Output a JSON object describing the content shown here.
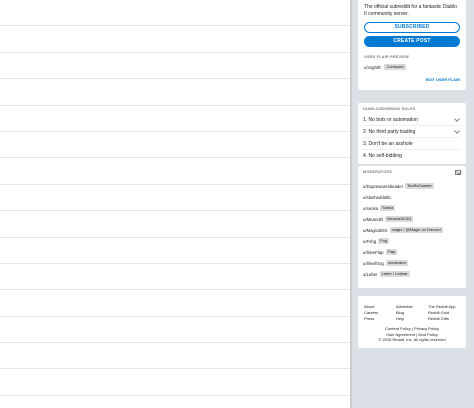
{
  "about": {
    "description": "The official subreddit for a fantastic Diablo II community server.",
    "subscribed_label": "SUBSCRIBED",
    "create_post_label": "CREATE POST"
  },
  "user_flair": {
    "title": "USER FLAIR PREVIEW",
    "username": "u/rxightfc",
    "flair": "Confused",
    "edit_label": "EDIT USER FLAIR"
  },
  "rules": {
    "title": "DIABLO2BOBBING RULES",
    "items": [
      {
        "label": "1. No bots or automation",
        "expandable": true
      },
      {
        "label": "2. No third party trading",
        "expandable": true
      },
      {
        "label": "3. Don't be an asshole",
        "expandable": false
      },
      {
        "label": "4. No self-bidding",
        "expandable": false
      }
    ]
  },
  "moderators": {
    "title": "MODERATORS",
    "items": [
      {
        "user": "u/Duprewaresbeader",
        "flair": "TeaRaToaster"
      },
      {
        "user": "u/slasheddaltic",
        "flair": ""
      },
      {
        "user": "u/senka",
        "flair": "Senka"
      },
      {
        "user": "u/Meandril",
        "flair": "Meandril2/3/4"
      },
      {
        "user": "u/MagicalEG",
        "flair": "magic / @Magic on Discord"
      },
      {
        "user": "u/Fshg",
        "flair": "Fog"
      },
      {
        "user": "u/SleeFlap",
        "flair": "Flap"
      },
      {
        "user": "u/Sleeftrog",
        "flair": "moderator"
      },
      {
        "user": "u/Leber",
        "flair": "Leber / Lebear"
      }
    ]
  },
  "footer": {
    "links": [
      "About",
      "Advertise",
      "The Reddit App",
      "Careers",
      "Blog",
      "Reddit Gold",
      "Press",
      "Help",
      "Reddit Gifts"
    ],
    "policy": "Content Policy | Privacy Policy",
    "agreement": "User Agreement | Mod Policy",
    "copyright": "© 2018 Reddit, Inc. All rights reserved"
  },
  "colors": {
    "accent": "#0079d3",
    "background": "#dae0e6",
    "tag_bg": "#dadada"
  }
}
